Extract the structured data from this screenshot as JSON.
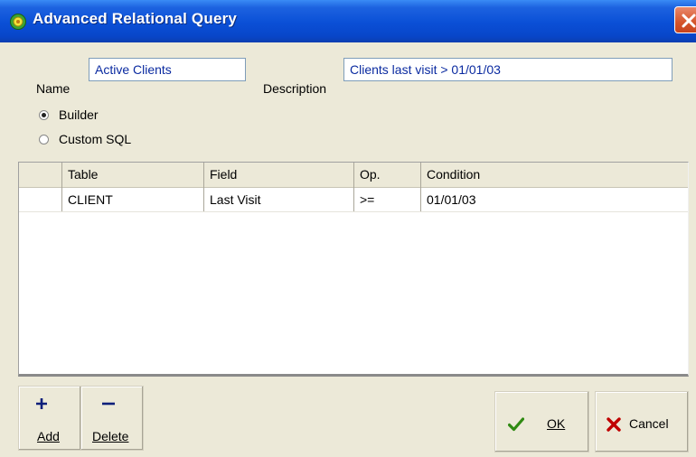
{
  "window": {
    "title": "Advanced Relational Query"
  },
  "form": {
    "name_label": "Name",
    "name_value": "Active Clients",
    "description_label": "Description",
    "description_value": "Clients last visit > 01/01/03",
    "mode_options": [
      {
        "label": "Builder",
        "selected": true
      },
      {
        "label": "Custom SQL",
        "selected": false
      }
    ]
  },
  "grid": {
    "columns": [
      "Table",
      "Field",
      "Op.",
      "Condition"
    ],
    "rows": [
      [
        "CLIENT",
        "Last Visit",
        ">=",
        "01/01/03"
      ]
    ]
  },
  "buttons": {
    "add": {
      "label": "Add",
      "icon": "plus-icon"
    },
    "delete": {
      "label": "Delete",
      "icon": "minus-icon"
    },
    "ok": {
      "label": "OK",
      "icon": "checkmark-icon"
    },
    "cancel": {
      "label": "Cancel",
      "icon": "x-icon"
    }
  },
  "colors": {
    "titlebar": "#0a4fd6",
    "close_button": "#d5552b",
    "field_text": "#0a2aa0",
    "ok_check": "#2f8a12",
    "cancel_x": "#c00000"
  }
}
